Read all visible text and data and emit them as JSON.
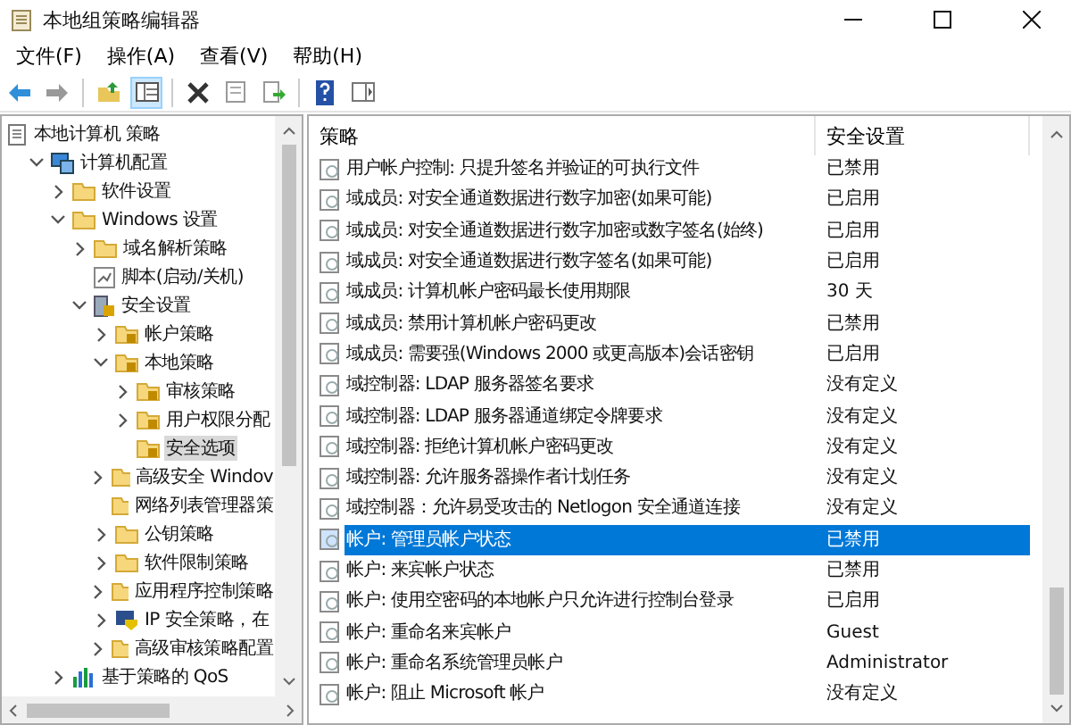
{
  "window": {
    "title": "本地组策略编辑器"
  },
  "menu": [
    "文件(F)",
    "操作(A)",
    "查看(V)",
    "帮助(H)"
  ],
  "toolbar": [
    {
      "kind": "back"
    },
    {
      "kind": "forward"
    },
    {
      "kind": "sep"
    },
    {
      "kind": "up"
    },
    {
      "kind": "pane",
      "selected": true
    },
    {
      "kind": "sep"
    },
    {
      "kind": "delete"
    },
    {
      "kind": "props"
    },
    {
      "kind": "export"
    },
    {
      "kind": "sep"
    },
    {
      "kind": "help"
    },
    {
      "kind": "view"
    }
  ],
  "tree": [
    {
      "label": "本地计算机 策略",
      "kind": "policy",
      "selected": false,
      "children": [
        {
          "label": "计算机配置",
          "kind": "computer",
          "expanded": true,
          "selected": false,
          "children": [
            {
              "label": "软件设置",
              "kind": "folder",
              "expanded": false,
              "selected": false
            },
            {
              "label": "Windows 设置",
              "kind": "folder",
              "expanded": true,
              "selected": false,
              "children": [
                {
                  "label": "域名解析策略",
                  "kind": "folder",
                  "expanded": false,
                  "selected": false
                },
                {
                  "label": "脚本(启动/关机)",
                  "kind": "script",
                  "selected": false
                },
                {
                  "label": "安全设置",
                  "kind": "security",
                  "expanded": true,
                  "selected": false,
                  "children": [
                    {
                      "label": "帐户策略",
                      "kind": "lockfolder",
                      "expanded": false,
                      "selected": false
                    },
                    {
                      "label": "本地策略",
                      "kind": "lockfolder",
                      "expanded": true,
                      "selected": false,
                      "children": [
                        {
                          "label": "审核策略",
                          "kind": "lockfolder",
                          "expanded": false,
                          "selected": false
                        },
                        {
                          "label": "用户权限分配",
                          "kind": "lockfolder",
                          "expanded": false,
                          "selected": false
                        },
                        {
                          "label": "安全选项",
                          "kind": "lockfolder",
                          "selected": true
                        }
                      ]
                    },
                    {
                      "label": "高级安全 Windov",
                      "kind": "folder",
                      "expanded": false,
                      "selected": false
                    },
                    {
                      "label": "网络列表管理器策",
                      "kind": "folder",
                      "selected": false
                    },
                    {
                      "label": "公钥策略",
                      "kind": "folder",
                      "expanded": false,
                      "selected": false
                    },
                    {
                      "label": "软件限制策略",
                      "kind": "folder",
                      "expanded": false,
                      "selected": false
                    },
                    {
                      "label": "应用程序控制策略",
                      "kind": "folder",
                      "expanded": false,
                      "selected": false
                    },
                    {
                      "label": "IP 安全策略，在",
                      "kind": "ip",
                      "expanded": false,
                      "selected": false
                    },
                    {
                      "label": "高级审核策略配置",
                      "kind": "folder",
                      "expanded": false,
                      "selected": false
                    }
                  ]
                }
              ]
            },
            {
              "label": "基于策略的 QoS",
              "kind": "chart",
              "expanded": false,
              "selected": false
            }
          ]
        }
      ]
    }
  ],
  "table": {
    "columns": [
      "策略",
      "安全设置"
    ],
    "rows": [
      {
        "policy": "用户帐户控制: 只提升签名并验证的可执行文件",
        "setting": "已禁用",
        "selected": false
      },
      {
        "policy": "域成员: 对安全通道数据进行数字加密(如果可能)",
        "setting": "已启用",
        "selected": false
      },
      {
        "policy": "域成员: 对安全通道数据进行数字加密或数字签名(始终)",
        "setting": "已启用",
        "selected": false
      },
      {
        "policy": "域成员: 对安全通道数据进行数字签名(如果可能)",
        "setting": "已启用",
        "selected": false
      },
      {
        "policy": "域成员: 计算机帐户密码最长使用期限",
        "setting": "30 天",
        "selected": false
      },
      {
        "policy": "域成员: 禁用计算机帐户密码更改",
        "setting": "已禁用",
        "selected": false
      },
      {
        "policy": "域成员: 需要强(Windows 2000 或更高版本)会话密钥",
        "setting": "已启用",
        "selected": false
      },
      {
        "policy": "域控制器: LDAP 服务器签名要求",
        "setting": "没有定义",
        "selected": false
      },
      {
        "policy": "域控制器: LDAP 服务器通道绑定令牌要求",
        "setting": "没有定义",
        "selected": false
      },
      {
        "policy": "域控制器: 拒绝计算机帐户密码更改",
        "setting": "没有定义",
        "selected": false
      },
      {
        "policy": "域控制器: 允许服务器操作者计划任务",
        "setting": "没有定义",
        "selected": false
      },
      {
        "policy": "域控制器：允许易受攻击的 Netlogon 安全通道连接",
        "setting": "没有定义",
        "selected": false
      },
      {
        "policy": "帐户: 管理员帐户状态",
        "setting": "已禁用",
        "selected": true
      },
      {
        "policy": "帐户: 来宾帐户状态",
        "setting": "已禁用",
        "selected": false
      },
      {
        "policy": "帐户: 使用空密码的本地帐户只允许进行控制台登录",
        "setting": "已启用",
        "selected": false
      },
      {
        "policy": "帐户: 重命名来宾帐户",
        "setting": "Guest",
        "selected": false
      },
      {
        "policy": "帐户: 重命名系统管理员帐户",
        "setting": "Administrator",
        "selected": false
      },
      {
        "policy": "帐户: 阻止 Microsoft 帐户",
        "setting": "没有定义",
        "selected": false
      }
    ]
  }
}
